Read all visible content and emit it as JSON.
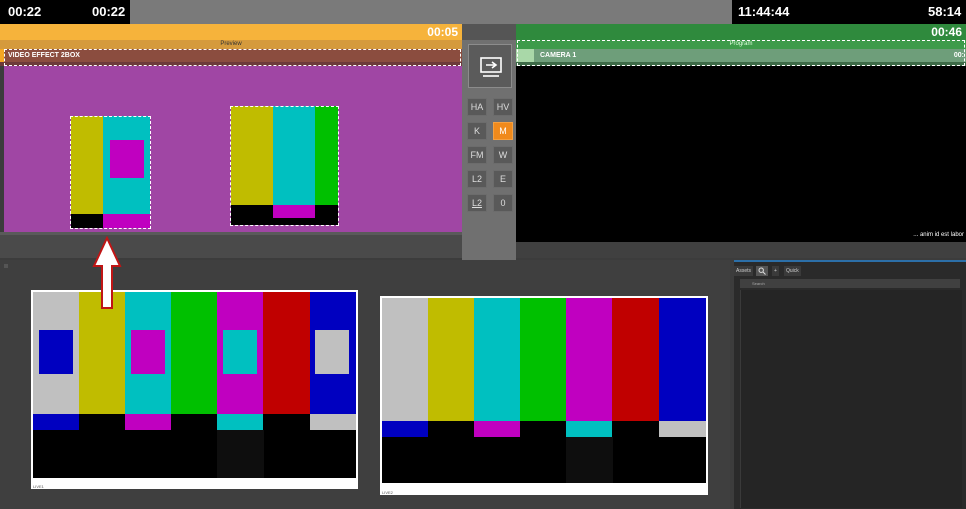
{
  "topbar": {
    "time_left_1": "00:22",
    "time_left_2": "00:22",
    "clock": "11:44:44",
    "time_right": "58:14"
  },
  "preview": {
    "countdown": "00:05",
    "label": "Preview",
    "source": "VIDEO EFFECT 2BOX"
  },
  "program": {
    "countdown": "00:46",
    "label": "Program",
    "source": "CAMERA 1",
    "source_time": "00:",
    "caption": "... anim id est labor"
  },
  "switcher": {
    "buttons": [
      "HA",
      "HV",
      "K",
      "M",
      "FM",
      "W",
      "L2",
      "E",
      "L2",
      "0"
    ],
    "active_index": 3
  },
  "monitors": {
    "left_label": "LIVE1",
    "right_label": "LIVE2"
  },
  "assets_panel": {
    "tab_assets": "Assets",
    "tab_plus": "+",
    "tab_quick": "Quick",
    "search_placeholder": "Search"
  },
  "colors": {
    "preview_accent": "#f6b33b",
    "program_accent": "#2f8a3d",
    "active_button": "#f08a1c",
    "preview_bg": "#a046a4"
  }
}
